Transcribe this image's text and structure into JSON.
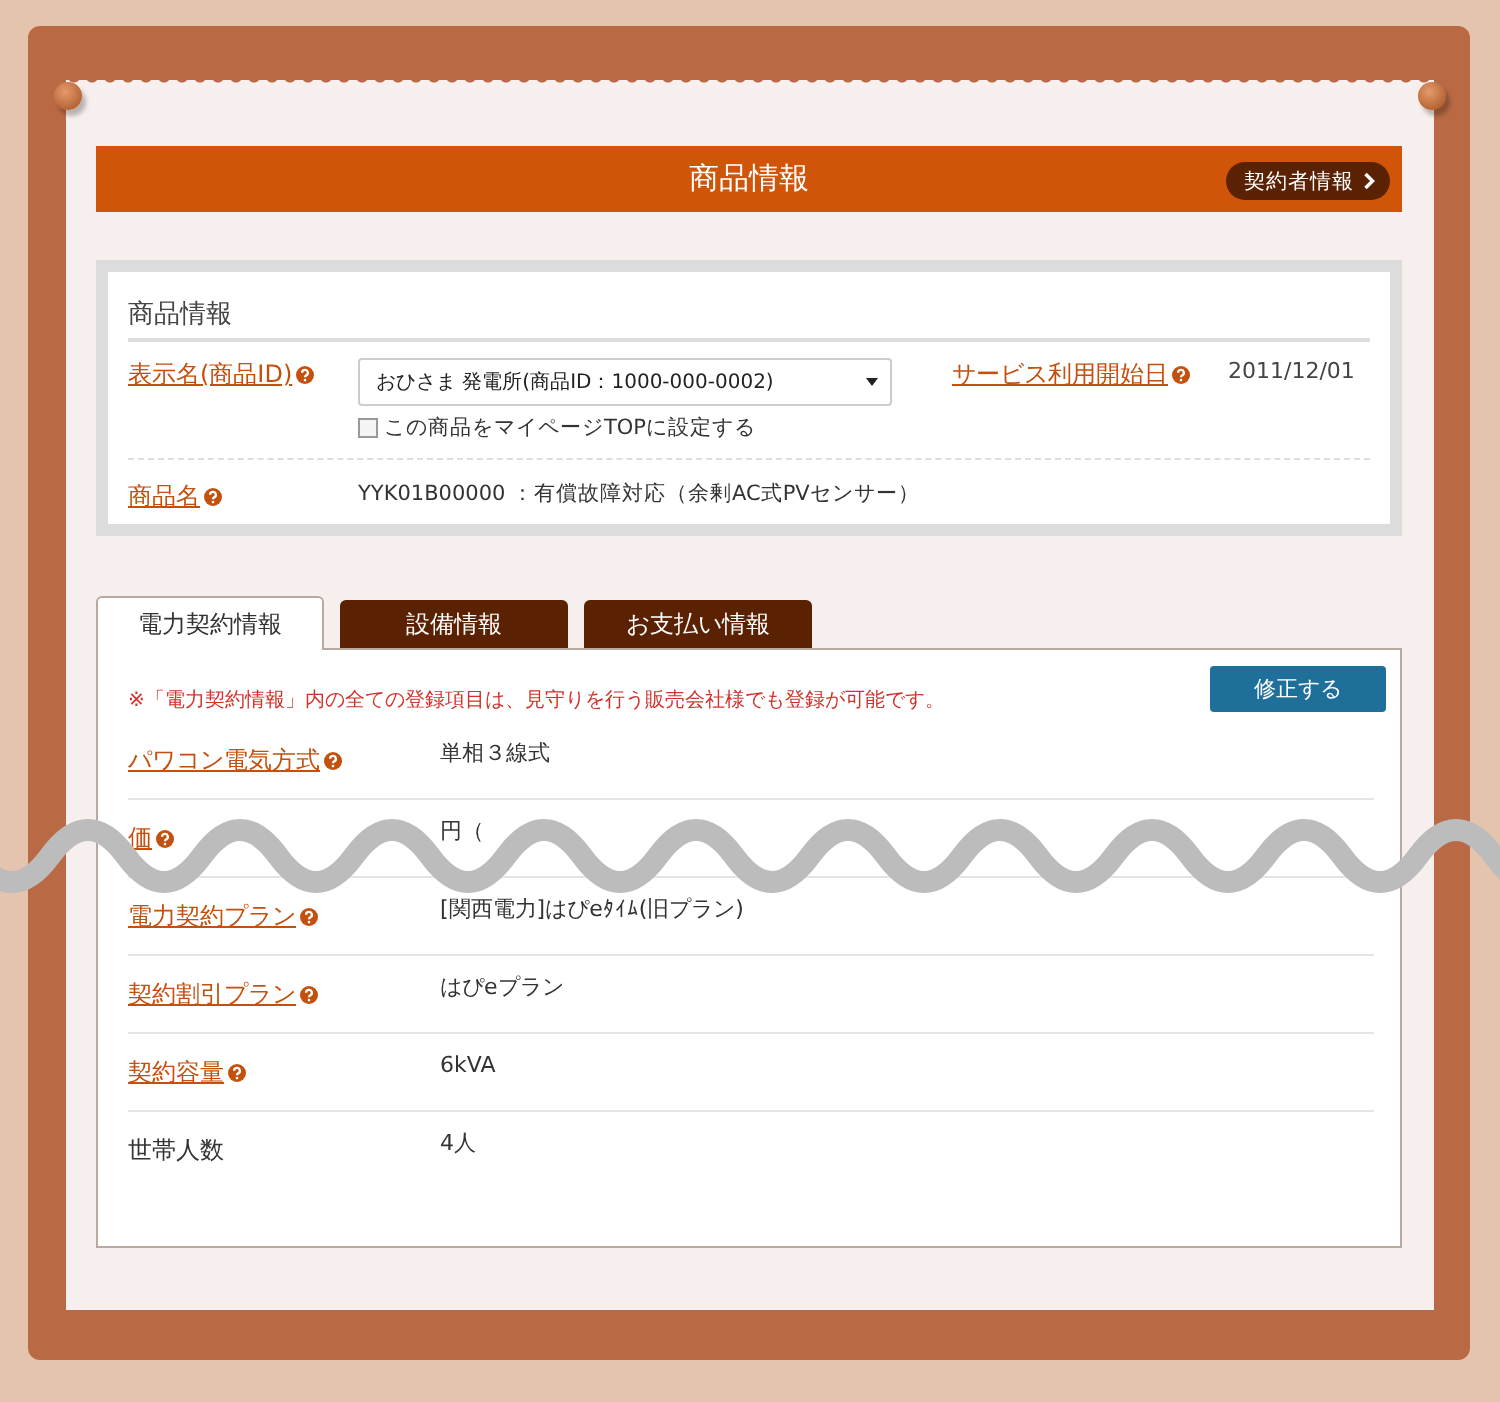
{
  "header": {
    "title": "商品情報",
    "contractor_button": "契約者情報"
  },
  "product_info": {
    "heading": "商品情報",
    "display_name": {
      "label": "表示名(商品ID)",
      "value": "おひさま 発電所(商品ID：1000-000-0002)",
      "checkbox": {
        "label": "この商品をマイページTOPに設定する",
        "checked": false
      }
    },
    "service_start": {
      "label": "サービス利用開始日",
      "value": "2011/12/01"
    },
    "product_name": {
      "label": "商品名",
      "value": "YYK01B00000 ：有償故障対応（余剰AC式PVセンサー）"
    }
  },
  "tabs": [
    {
      "label": "電力契約情報",
      "selected": true
    },
    {
      "label": "設備情報",
      "selected": false
    },
    {
      "label": "お支払い情報",
      "selected": false
    }
  ],
  "notice": "※「電力契約情報」内の全ての登録項目は、見守りを行う販売会社様でも登録が可能です。",
  "edit_button": "修正する",
  "rows": [
    {
      "kind": "link",
      "label": "パワコン電気方式",
      "value": "単相３線式"
    },
    {
      "kind": "link",
      "label": "価",
      "value": "円（"
    },
    {
      "kind": "link",
      "label": "電力契約プラン",
      "value": "[関西電力]はぴeﾀｲﾑ(旧プラン)"
    },
    {
      "kind": "link",
      "label": "契約割引プラン",
      "value": "はぴeプラン"
    },
    {
      "kind": "link",
      "label": "契約容量",
      "value": "6kVA"
    },
    {
      "kind": "plain",
      "label": "世帯人数",
      "value": "4人"
    }
  ]
}
